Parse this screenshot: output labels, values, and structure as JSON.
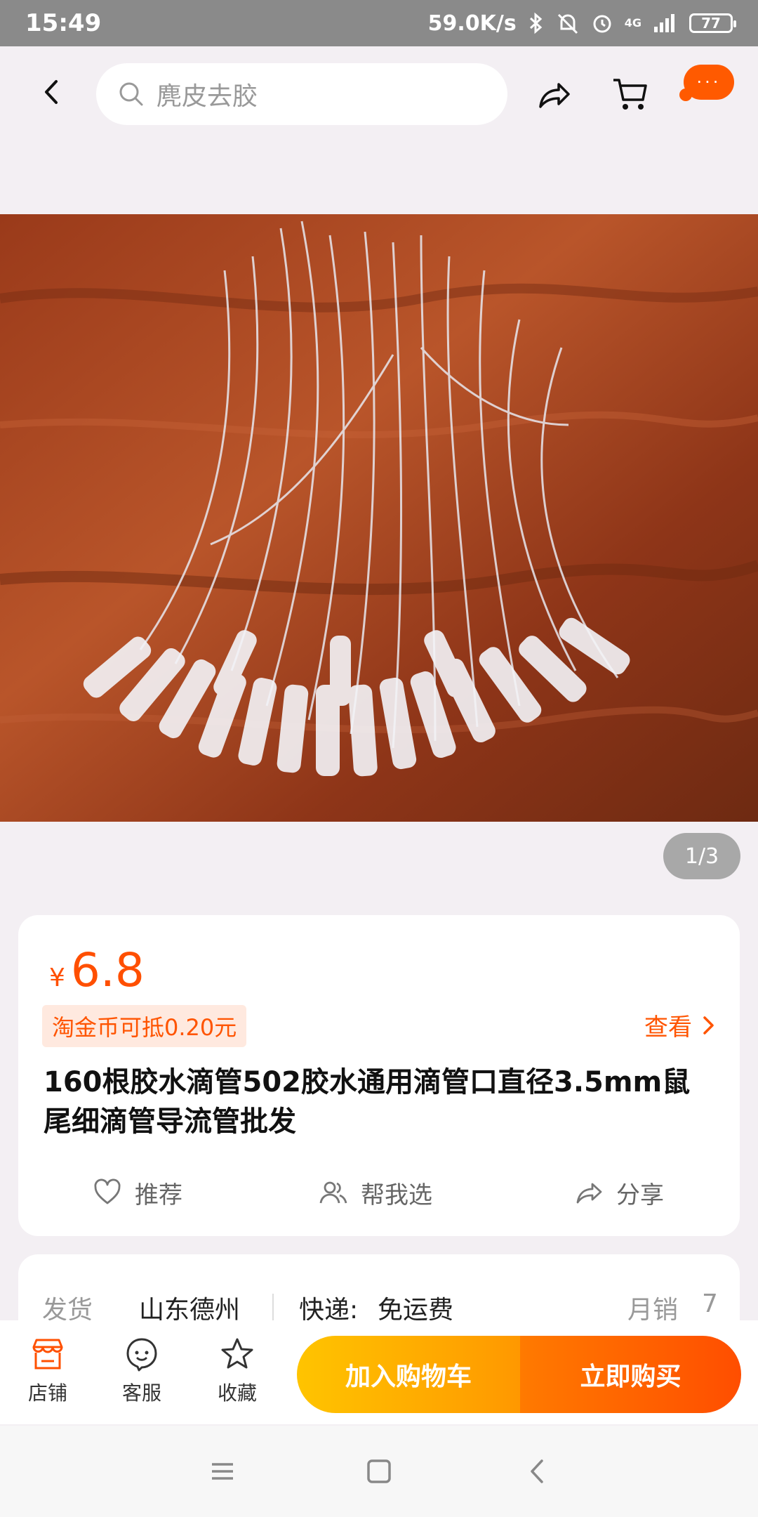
{
  "status_bar": {
    "time": "15:49",
    "speed": "59.0K/s",
    "network": "4G",
    "battery": "77"
  },
  "top_nav": {
    "search_placeholder": "麂皮去胶",
    "more_label": "···"
  },
  "gallery": {
    "indicator": "1/3"
  },
  "product": {
    "currency": "¥",
    "price": "6.8",
    "coin_offer": "淘金币可抵0.20元",
    "view_label": "查看",
    "title": "160根胶水滴管502胶水通用滴管口直径3.5mm鼠尾细滴管导流管批发",
    "actions": {
      "recommend": "推荐",
      "help_choose": "帮我选",
      "share": "分享"
    }
  },
  "shipping": {
    "ship_label": "发货",
    "ship_from": "山东德州",
    "express_label": "快递:",
    "express_value": "免运费",
    "sales_label": "月销",
    "sales_value": "7"
  },
  "bottom_bar": {
    "shop": "店铺",
    "service": "客服",
    "favorite": "收藏",
    "add_to_cart": "加入购物车",
    "buy_now": "立即购买"
  },
  "colors": {
    "accent": "#ff5000",
    "price": "#ff4f00",
    "cart_button": "#ffb300",
    "buy_button": "#ff5a00"
  }
}
